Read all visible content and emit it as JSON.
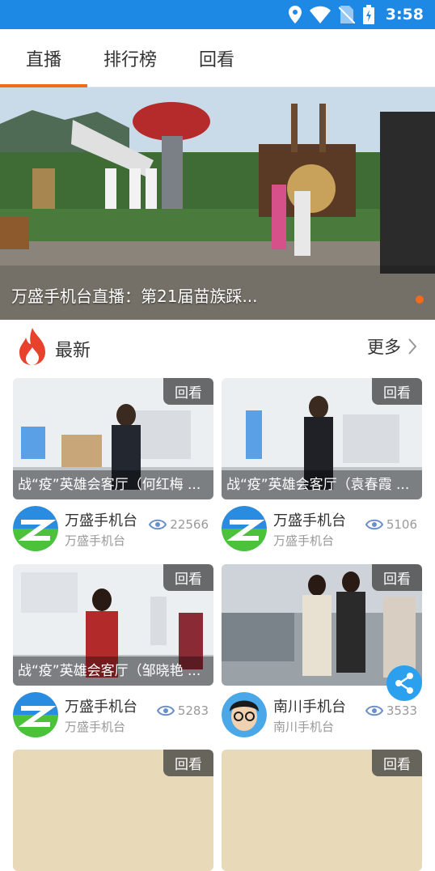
{
  "status": {
    "time": "3:58",
    "icons": [
      "location-icon",
      "wifi-icon",
      "no-sim-icon",
      "battery-icon"
    ]
  },
  "tabs": [
    {
      "label": "直播",
      "active": true
    },
    {
      "label": "排行榜",
      "active": false
    },
    {
      "label": "回看",
      "active": false
    }
  ],
  "banner": {
    "caption": "万盛手机台直播：第21届苗族踩..."
  },
  "section": {
    "title": "最新",
    "more": "更多"
  },
  "cards": [
    {
      "badge": "回看",
      "title": "战“疫”英雄会客厅（何红梅 ...",
      "channel": "万盛手机台",
      "sub": "万盛手机台",
      "views": "22566"
    },
    {
      "badge": "回看",
      "title": "战“疫”英雄会客厅（袁春霞 ...",
      "channel": "万盛手机台",
      "sub": "万盛手机台",
      "views": "5106"
    },
    {
      "badge": "回看",
      "title": "战“疫”英雄会客厅（邹晓艳 ...",
      "channel": "万盛手机台",
      "sub": "万盛手机台",
      "views": "5283"
    },
    {
      "badge": "回看",
      "title": "",
      "channel": "南川手机台",
      "sub": "南川手机台",
      "views": "3533"
    },
    {
      "badge": "回看",
      "title": "",
      "channel": "",
      "sub": "",
      "views": ""
    },
    {
      "badge": "回看",
      "title": "",
      "channel": "",
      "sub": "",
      "views": ""
    }
  ],
  "colors": {
    "status_bar": "#1e88e5",
    "accent": "#f26b1d",
    "share": "#2aa0ef"
  }
}
